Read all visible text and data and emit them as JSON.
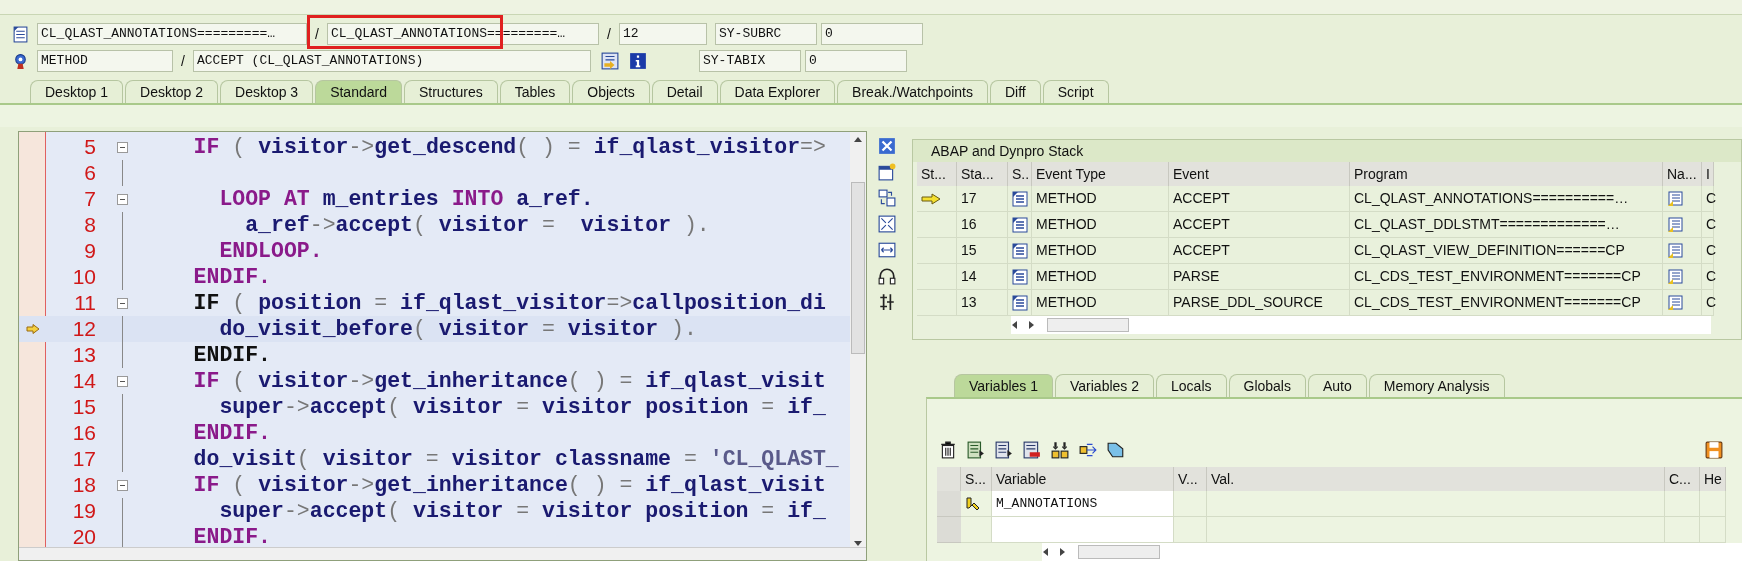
{
  "position": {
    "include": "CL_QLAST_ANNOTATIONS=========…",
    "program": {
      "text": "CL_QLAST_ANNOTATIONS=========…",
      "highlighted": true
    },
    "line": "12",
    "event_type": "METHOD",
    "event": "ACCEPT (CL_QLAST_ANNOTATIONS)",
    "separator": "/"
  },
  "sysfields": [
    {
      "name": "SY-SUBRC",
      "value": "0"
    },
    {
      "name": "SY-TABIX",
      "value": "0"
    }
  ],
  "tabs": [
    {
      "label": "Desktop 1",
      "selected": false
    },
    {
      "label": "Desktop 2",
      "selected": false
    },
    {
      "label": "Desktop 3",
      "selected": false
    },
    {
      "label": "Standard",
      "selected": true
    },
    {
      "label": "Structures",
      "selected": false
    },
    {
      "label": "Tables",
      "selected": false
    },
    {
      "label": "Objects",
      "selected": false
    },
    {
      "label": "Detail",
      "selected": false
    },
    {
      "label": "Data Explorer",
      "selected": false
    },
    {
      "label": "Break./Watchpoints",
      "selected": false
    },
    {
      "label": "Diff",
      "selected": false
    },
    {
      "label": "Script",
      "selected": false
    }
  ],
  "code": [
    {
      "number": "5",
      "fold": true,
      "current": false,
      "segments": [
        {
          "kind": "keyword",
          "text": "    IF"
        },
        {
          "kind": "punct",
          "text": " ( "
        },
        {
          "kind": "name",
          "text": "visitor"
        },
        {
          "kind": "punct",
          "text": "->"
        },
        {
          "kind": "name",
          "text": "get_descend"
        },
        {
          "kind": "punct",
          "text": "( ) = "
        },
        {
          "kind": "name",
          "text": "if_qlast_visitor"
        },
        {
          "kind": "punct",
          "text": "=>"
        }
      ]
    },
    {
      "number": "6",
      "fold": false,
      "current": false
    },
    {
      "number": "7",
      "fold": true,
      "current": false,
      "segments": [
        {
          "kind": "keyword",
          "text": "      LOOP AT"
        },
        {
          "kind": "name",
          "text": " m_entries "
        },
        {
          "kind": "keyword",
          "text": "INTO"
        },
        {
          "kind": "name",
          "text": " a_ref."
        }
      ]
    },
    {
      "number": "8",
      "fold": false,
      "current": false,
      "segments": [
        {
          "kind": "name",
          "text": "        a_ref"
        },
        {
          "kind": "punct",
          "text": "->"
        },
        {
          "kind": "name",
          "text": "accept"
        },
        {
          "kind": "punct",
          "text": "( "
        },
        {
          "kind": "name",
          "text": "visitor"
        },
        {
          "kind": "punct",
          "text": " =  "
        },
        {
          "kind": "name",
          "text": "visitor"
        },
        {
          "kind": "punct",
          "text": " )."
        }
      ]
    },
    {
      "number": "9",
      "fold": false,
      "current": false,
      "segments": [
        {
          "kind": "keyword",
          "text": "      ENDLOOP."
        }
      ]
    },
    {
      "number": "10",
      "fold": false,
      "current": false,
      "segments": [
        {
          "kind": "keyword",
          "text": "    ENDIF."
        }
      ]
    },
    {
      "number": "11",
      "fold": true,
      "current": false,
      "segments": [
        {
          "kind": "active",
          "text": "    IF"
        },
        {
          "kind": "punct",
          "text": " ( "
        },
        {
          "kind": "name",
          "text": "position"
        },
        {
          "kind": "punct",
          "text": " = "
        },
        {
          "kind": "name",
          "text": "if_qlast_visitor"
        },
        {
          "kind": "punct",
          "text": "=>"
        },
        {
          "kind": "name",
          "text": "callposition_di"
        }
      ]
    },
    {
      "number": "12",
      "fold": false,
      "current": true,
      "segments": [
        {
          "kind": "name",
          "text": "      do_visit_before"
        },
        {
          "kind": "punct",
          "text": "( "
        },
        {
          "kind": "name",
          "text": "visitor"
        },
        {
          "kind": "punct",
          "text": " = "
        },
        {
          "kind": "name",
          "text": "visitor"
        },
        {
          "kind": "punct",
          "text": " )."
        }
      ]
    },
    {
      "number": "13",
      "fold": false,
      "current": false,
      "segments": [
        {
          "kind": "active",
          "text": "    ENDIF."
        }
      ]
    },
    {
      "number": "14",
      "fold": true,
      "current": false,
      "segments": [
        {
          "kind": "keyword",
          "text": "    IF"
        },
        {
          "kind": "punct",
          "text": " ( "
        },
        {
          "kind": "name",
          "text": "visitor"
        },
        {
          "kind": "punct",
          "text": "->"
        },
        {
          "kind": "name",
          "text": "get_inheritance"
        },
        {
          "kind": "punct",
          "text": "( ) = "
        },
        {
          "kind": "name",
          "text": "if_qlast_visit"
        }
      ]
    },
    {
      "number": "15",
      "fold": false,
      "current": false,
      "segments": [
        {
          "kind": "name",
          "text": "      super"
        },
        {
          "kind": "punct",
          "text": "->"
        },
        {
          "kind": "name",
          "text": "accept"
        },
        {
          "kind": "punct",
          "text": "( "
        },
        {
          "kind": "name",
          "text": "visitor"
        },
        {
          "kind": "punct",
          "text": " = "
        },
        {
          "kind": "name",
          "text": "visitor position"
        },
        {
          "kind": "punct",
          "text": " = "
        },
        {
          "kind": "name",
          "text": "if_"
        }
      ]
    },
    {
      "number": "16",
      "fold": false,
      "current": false,
      "segments": [
        {
          "kind": "keyword",
          "text": "    ENDIF."
        }
      ]
    },
    {
      "number": "17",
      "fold": false,
      "current": false,
      "segments": [
        {
          "kind": "name",
          "text": "    do_visit"
        },
        {
          "kind": "punct",
          "text": "( "
        },
        {
          "kind": "name",
          "text": "visitor"
        },
        {
          "kind": "punct",
          "text": " = "
        },
        {
          "kind": "name",
          "text": "visitor classname"
        },
        {
          "kind": "punct",
          "text": " = "
        },
        {
          "kind": "literal",
          "text": "'CL_QLAST_"
        }
      ]
    },
    {
      "number": "18",
      "fold": true,
      "current": false,
      "segments": [
        {
          "kind": "keyword",
          "text": "    IF"
        },
        {
          "kind": "punct",
          "text": " ( "
        },
        {
          "kind": "name",
          "text": "visitor"
        },
        {
          "kind": "punct",
          "text": "->"
        },
        {
          "kind": "name",
          "text": "get_inheritance"
        },
        {
          "kind": "punct",
          "text": "( ) = "
        },
        {
          "kind": "name",
          "text": "if_qlast_visit"
        }
      ]
    },
    {
      "number": "19",
      "fold": false,
      "current": false,
      "segments": [
        {
          "kind": "name",
          "text": "      super"
        },
        {
          "kind": "punct",
          "text": "->"
        },
        {
          "kind": "name",
          "text": "accept"
        },
        {
          "kind": "punct",
          "text": "( "
        },
        {
          "kind": "name",
          "text": "visitor"
        },
        {
          "kind": "punct",
          "text": " = "
        },
        {
          "kind": "name",
          "text": "visitor position"
        },
        {
          "kind": "punct",
          "text": " = "
        },
        {
          "kind": "name",
          "text": "if_"
        }
      ]
    },
    {
      "number": "20",
      "fold": false,
      "current": false,
      "segments": [
        {
          "kind": "keyword",
          "text": "    ENDIF."
        }
      ]
    }
  ],
  "stack": {
    "title": "ABAP and Dynpro Stack",
    "columns": [
      "St...",
      "Sta...",
      "S..",
      "Event Type",
      "Event",
      "Program",
      "Na...",
      "I"
    ],
    "rows": [
      {
        "current": true,
        "level": "17",
        "event_type": "METHOD",
        "event": "ACCEPT",
        "program": "CL_QLAST_ANNOTATIONS==========…",
        "column_8": "C"
      },
      {
        "current": false,
        "level": "16",
        "event_type": "METHOD",
        "event": "ACCEPT",
        "program": "CL_QLAST_DDLSTMT=============…",
        "column_8": "C"
      },
      {
        "current": false,
        "level": "15",
        "event_type": "METHOD",
        "event": "ACCEPT",
        "program": "CL_QLAST_VIEW_DEFINITION======CP",
        "column_8": "C"
      },
      {
        "current": false,
        "level": "14",
        "event_type": "METHOD",
        "event": "PARSE",
        "program": "CL_CDS_TEST_ENVIRONMENT=======CP",
        "column_8": "C"
      },
      {
        "current": false,
        "level": "13",
        "event_type": "METHOD",
        "event": "PARSE_DDL_SOURCE",
        "program": "CL_CDS_TEST_ENVIRONMENT=======CP",
        "column_8": "C"
      }
    ]
  },
  "variable_tabs": [
    {
      "label": "Variables 1",
      "selected": true
    },
    {
      "label": "Variables 2",
      "selected": false
    },
    {
      "label": "Locals",
      "selected": false
    },
    {
      "label": "Globals",
      "selected": false
    },
    {
      "label": "Auto",
      "selected": false
    },
    {
      "label": "Memory Analysis",
      "selected": false
    }
  ],
  "variables": {
    "columns": [
      "S...",
      "Variable",
      "V...",
      "Val.",
      "C...",
      "He"
    ],
    "rows": [
      {
        "variable": "M_ANNOTATIONS"
      }
    ]
  }
}
